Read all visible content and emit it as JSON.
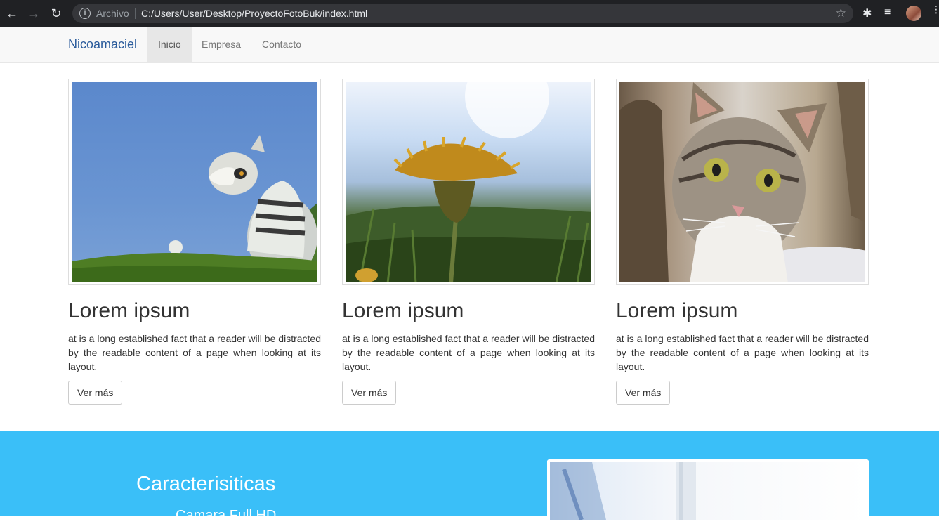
{
  "browser": {
    "scheme_label": "Archivo",
    "url": "C:/Users/User/Desktop/ProyectoFotoBuk/index.html"
  },
  "navbar": {
    "brand": "Nicoamaciel",
    "items": [
      {
        "label": "Inicio",
        "active": true
      },
      {
        "label": "Empresa",
        "active": false
      },
      {
        "label": "Contacto",
        "active": false
      }
    ]
  },
  "cards": [
    {
      "image": "lemur-photo",
      "title": "Lorem ipsum",
      "text": "at is a long established fact that a reader will be distracted by the readable content of a page when looking at its layout.",
      "button": "Ver más"
    },
    {
      "image": "dandelion-photo",
      "title": "Lorem ipsum",
      "text": "at is a long established fact that a reader will be distracted by the readable content of a page when looking at its layout.",
      "button": "Ver más"
    },
    {
      "image": "cat-photo",
      "title": "Lorem ipsum",
      "text": "at is a long established fact that a reader will be distracted by the readable content of a page when looking at its layout.",
      "button": "Ver más"
    }
  ],
  "features": {
    "title": "Caracterisiticas",
    "first_item": "Camara Full HD",
    "background_color": "#3abff8"
  },
  "colors": {
    "brand": "#2a5b9b",
    "chrome": "#202124"
  }
}
